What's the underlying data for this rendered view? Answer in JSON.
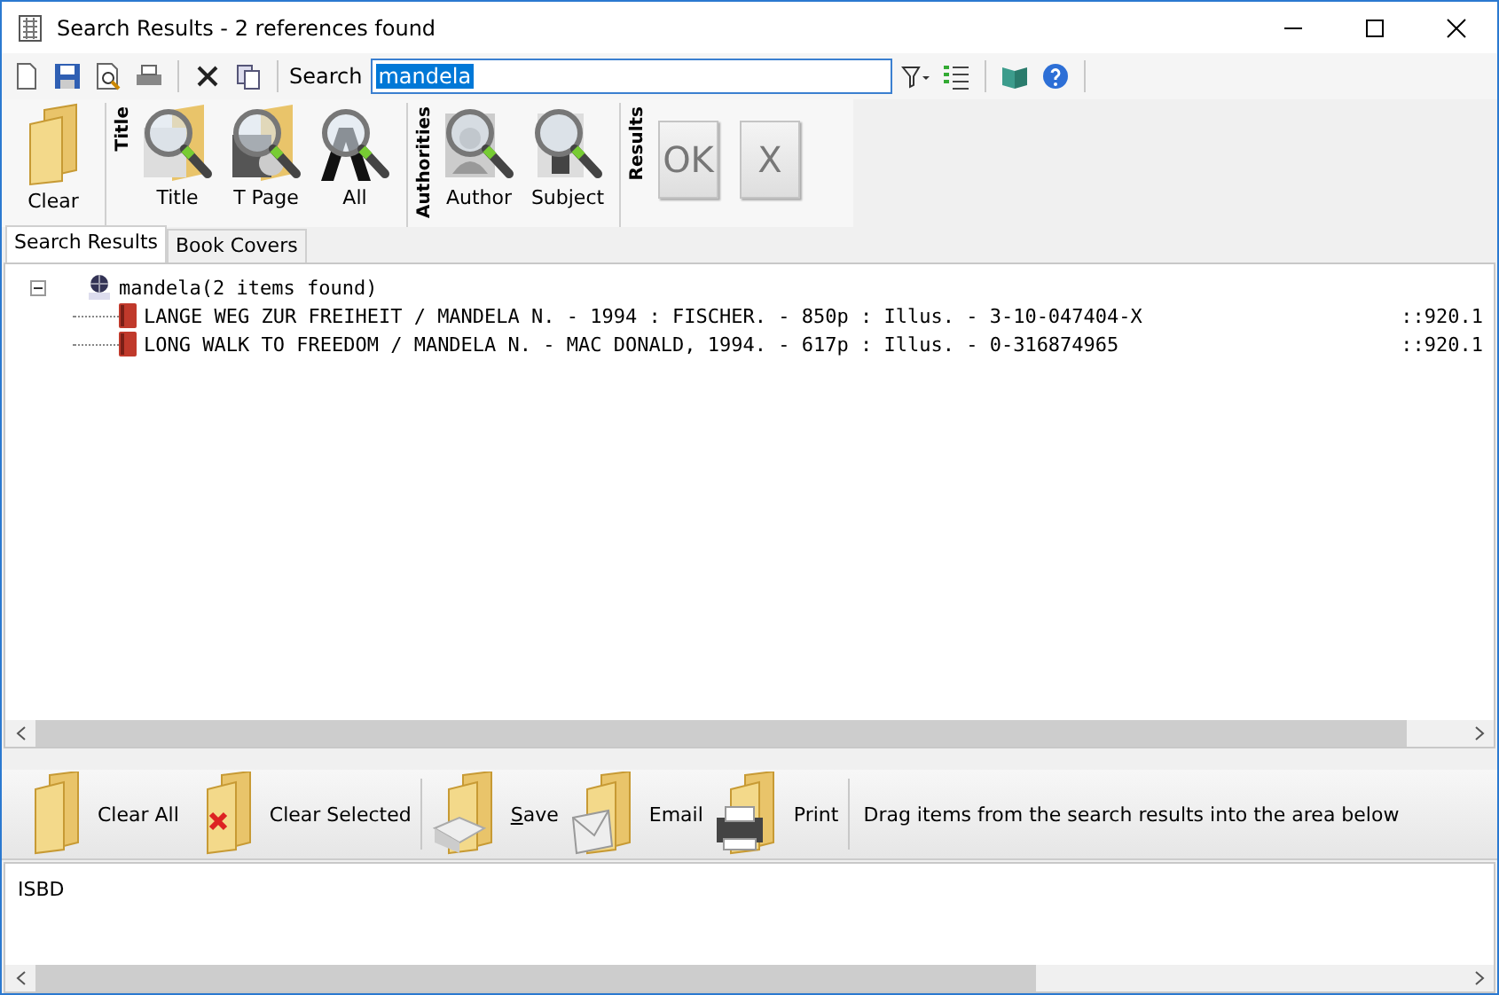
{
  "window": {
    "title": "Search Results - 2 references found"
  },
  "toolbar": {
    "search_label": "Search",
    "search_value": "mandela"
  },
  "ribbon": {
    "groups": [
      {
        "buttons": [
          {
            "label": "Clear",
            "kind": "folder"
          }
        ]
      },
      {
        "title": "Title",
        "buttons": [
          {
            "label": "Title",
            "kind": "search-doc"
          },
          {
            "label": "T Page",
            "kind": "search-page"
          },
          {
            "label": "All",
            "kind": "search-letter"
          }
        ]
      },
      {
        "title": "Authorities",
        "buttons": [
          {
            "label": "Author",
            "kind": "search-person"
          },
          {
            "label": "Subject",
            "kind": "search-subject"
          }
        ]
      },
      {
        "title": "Results",
        "buttons": [
          {
            "label": "OK",
            "kind": "tile"
          },
          {
            "label": "X",
            "kind": "tile"
          }
        ]
      }
    ]
  },
  "tabs": [
    {
      "label": "Search Results",
      "selected": true
    },
    {
      "label": "Book Covers",
      "selected": false
    }
  ],
  "tree": {
    "label": "mandela(2 items found)",
    "expanded": true,
    "children": [
      {
        "label": "LANGE WEG ZUR FREIHEIT / MANDELA N. - 1994 : FISCHER. - 850p : Illus. - 3-10-047404-X",
        "column_2": "::920.1"
      },
      {
        "label": "LONG WALK TO FREEDOM / MANDELA N. - MAC DONALD, 1994. - 617p : Illus. - 0-316874965",
        "column_2": "::920.1"
      }
    ]
  },
  "actions": [
    {
      "label": "Clear All",
      "kind": "folder"
    },
    {
      "label": "Clear Selected",
      "kind": "folder-x"
    },
    {
      "label": "Save",
      "kind": "save",
      "underline_first": true
    },
    {
      "label": "Email",
      "kind": "email"
    },
    {
      "label": "Print",
      "kind": "print"
    }
  ],
  "hint": "Drag items from the search results into the area below",
  "output": {
    "label": "ISBD"
  }
}
